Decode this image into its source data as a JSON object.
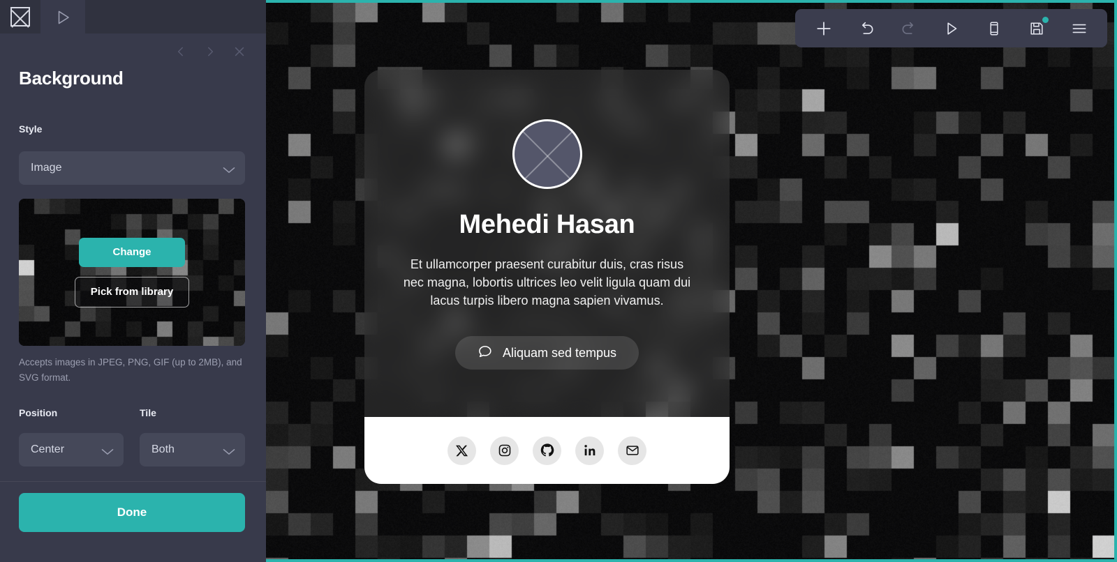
{
  "sidebar": {
    "tabs": [
      {
        "name": "design-tab",
        "icon": "square-x-icon"
      },
      {
        "name": "preview-tab",
        "icon": "play-icon"
      }
    ],
    "panel_nav": [
      {
        "name": "prev-panel-button",
        "icon": "chevron-left-icon"
      },
      {
        "name": "next-panel-button",
        "icon": "chevron-right-icon"
      },
      {
        "name": "close-panel-button",
        "icon": "close-icon"
      }
    ],
    "title": "Background",
    "style": {
      "label": "Style",
      "value": "Image",
      "options": [
        "Image",
        "Color",
        "Gradient",
        "Video",
        "None"
      ]
    },
    "preview": {
      "change_label": "Change",
      "library_label": "Pick from library"
    },
    "accepts_note": "Accepts images in JPEG, PNG, GIF (up to 2MB), and SVG format.",
    "position": {
      "label": "Position",
      "value": "Center",
      "options": [
        "Center",
        "Top",
        "Bottom",
        "Left",
        "Right"
      ]
    },
    "tile": {
      "label": "Tile",
      "value": "Both",
      "options": [
        "Both",
        "Horizontal",
        "Vertical",
        "None"
      ]
    },
    "done_label": "Done"
  },
  "toolbar": {
    "items": [
      {
        "name": "add-button",
        "icon": "plus-icon",
        "disabled": false,
        "badge": false
      },
      {
        "name": "undo-button",
        "icon": "undo-icon",
        "disabled": false,
        "badge": false
      },
      {
        "name": "redo-button",
        "icon": "redo-icon",
        "disabled": true,
        "badge": false
      },
      {
        "name": "preview-button",
        "icon": "play-icon",
        "disabled": false,
        "badge": false
      },
      {
        "name": "device-preview-button",
        "icon": "mobile-icon",
        "disabled": false,
        "badge": false
      },
      {
        "name": "save-button",
        "icon": "save-icon",
        "disabled": false,
        "badge": true
      },
      {
        "name": "menu-button",
        "icon": "hamburger-icon",
        "disabled": false,
        "badge": false
      }
    ]
  },
  "card": {
    "avatar_icon": "avatar-placeholder-icon",
    "name": "Mehedi Hasan",
    "description": "Et ullamcorper praesent curabitur duis, cras risus nec magna, lobortis ultrices leo velit ligula quam dui lacus turpis libero magna sapien vivamus.",
    "cta": {
      "icon": "chat-bubble-icon",
      "label": "Aliquam sed tempus"
    },
    "socials": [
      {
        "name": "social-x",
        "icon": "x-icon"
      },
      {
        "name": "social-instagram",
        "icon": "instagram-icon"
      },
      {
        "name": "social-github",
        "icon": "github-icon"
      },
      {
        "name": "social-linkedin",
        "icon": "linkedin-icon"
      },
      {
        "name": "social-email",
        "icon": "email-icon"
      }
    ]
  },
  "colors": {
    "accent": "#2bb3ad",
    "sidebar_bg": "#383a4b",
    "control_bg": "#454859",
    "canvas_bg": "#0b0b0c",
    "footer_bg": "#ffffff"
  }
}
